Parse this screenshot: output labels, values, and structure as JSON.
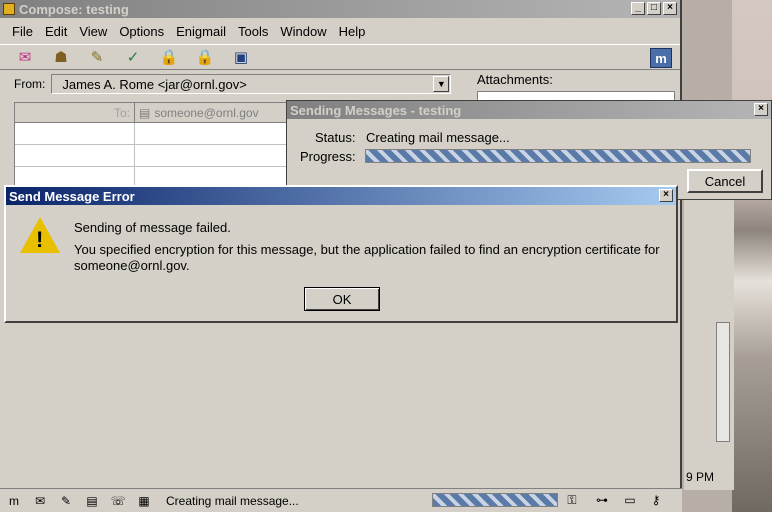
{
  "compose": {
    "title": "Compose: testing",
    "menu": [
      "File",
      "Edit",
      "View",
      "Options",
      "Enigmail",
      "Tools",
      "Window",
      "Help"
    ],
    "from_label": "From:",
    "from_value": "James A. Rome <jar@ornl.gov>",
    "to_label": "To:",
    "to_value": "someone@ornl.gov",
    "attachments_label": "Attachments:",
    "status_text": "Creating mail message...",
    "clock_fragment": "9 PM",
    "brand_letter": "m",
    "toolbar_icons": [
      "send-icon",
      "address-icon",
      "attach-icon",
      "spell-icon",
      "security-icon",
      "enigmail-icon",
      "save-icon"
    ]
  },
  "sending_dialog": {
    "title": "Sending Messages - testing",
    "status_label": "Status:",
    "status_value": "Creating mail message...",
    "progress_label": "Progress:",
    "cancel_label": "Cancel"
  },
  "error_dialog": {
    "title": "Send Message Error",
    "line1": "Sending of message failed.",
    "line2": "You specified encryption for this message, but the application failed to find an encryption certificate for",
    "line3": "someone@ornl.gov.",
    "ok_label": "OK"
  },
  "colors": {
    "active_title": "#0a246a",
    "inactive_title": "#808080",
    "warning": "#e8c000"
  }
}
